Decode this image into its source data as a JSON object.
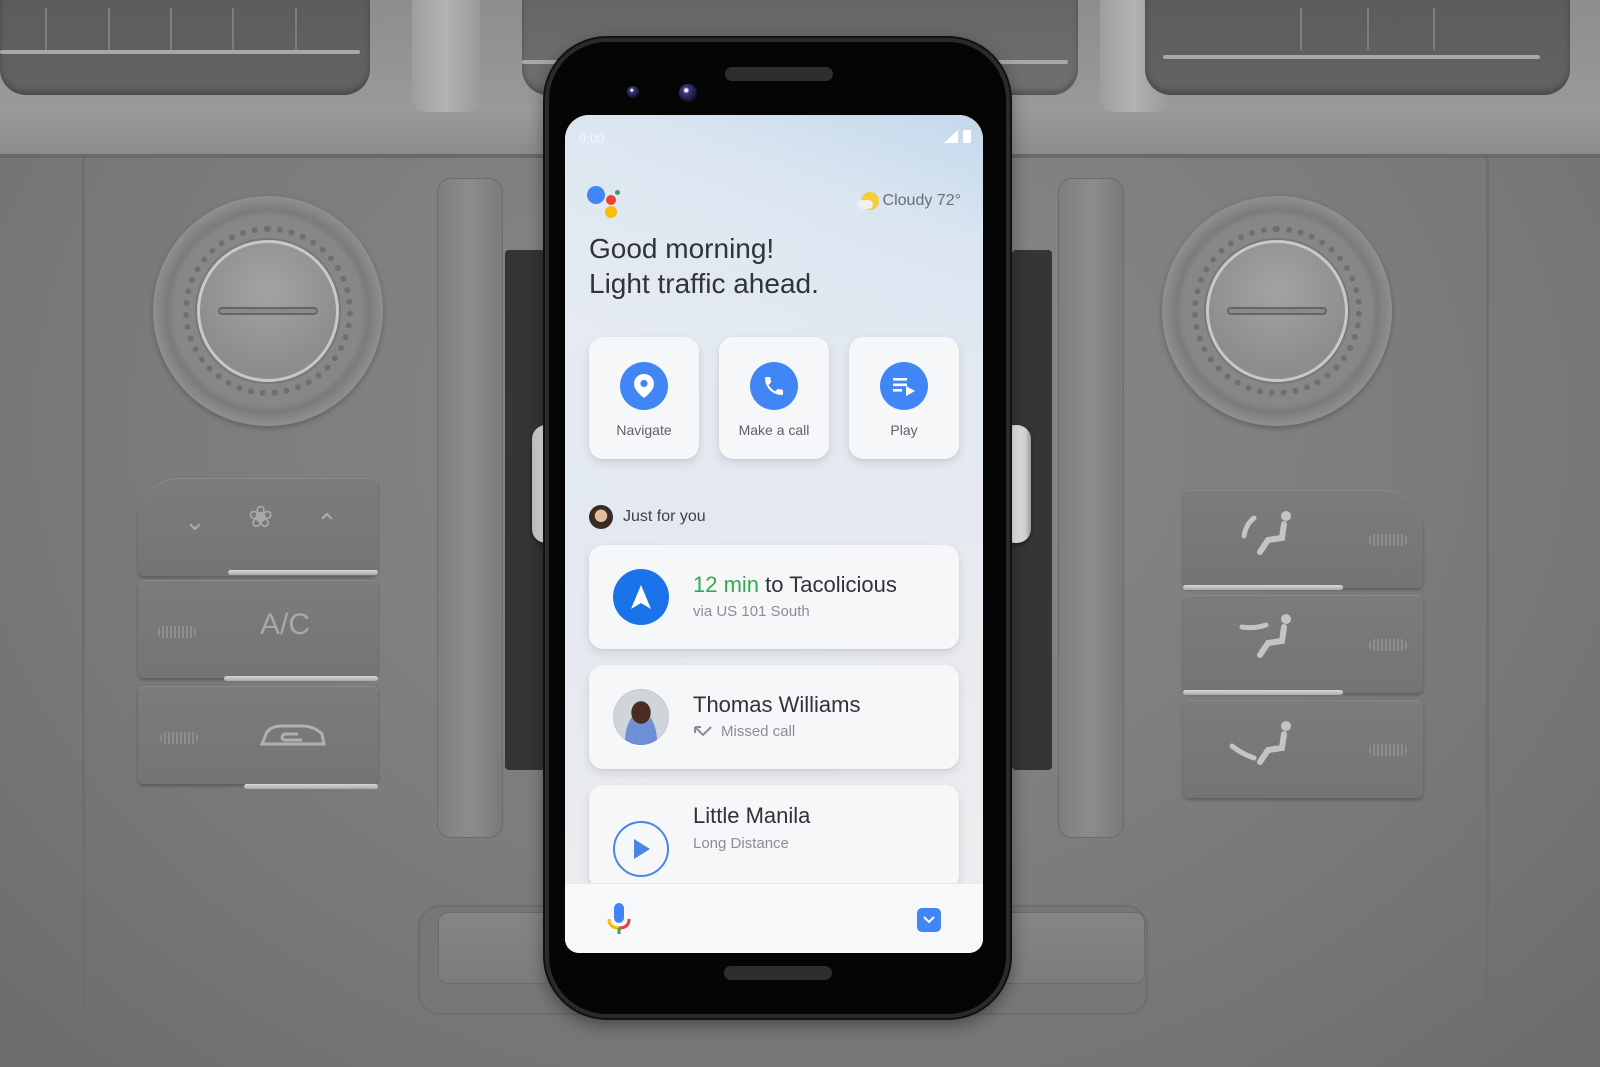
{
  "background": {
    "dash_labels": {
      "ac": "A/C"
    }
  },
  "phone": {
    "status_bar": {
      "time": "9:00",
      "signal_icon": "cell-signal-icon",
      "battery_icon": "battery-icon"
    },
    "header": {
      "assistant_logo": "google-assistant-logo",
      "weather": {
        "icon": "partly-cloudy-icon",
        "text": "Cloudy 72°"
      },
      "greeting_line1": "Good morning!",
      "greeting_line2": "Light traffic ahead."
    },
    "quick_actions": [
      {
        "label": "Navigate",
        "icon": "location-pin-icon"
      },
      {
        "label": "Make a call",
        "icon": "phone-icon"
      },
      {
        "label": "Play",
        "icon": "playlist-play-icon"
      }
    ],
    "section": {
      "label": "Just for you",
      "avatar_icon": "user-avatar"
    },
    "cards": [
      {
        "highlight": "12 min",
        "title_rest": " to Tacolicious",
        "subtitle": "via US 101 South",
        "icon": "navigation-arrow-icon"
      },
      {
        "title": "Thomas Williams",
        "subtitle": "Missed call",
        "subtitle_icon": "missed-call-icon",
        "icon": "contact-photo"
      },
      {
        "title": "Little Manila",
        "subtitle": "Long Distance",
        "icon": "play-icon"
      }
    ],
    "bottom_bar": {
      "mic_icon": "microphone-icon",
      "keyboard_icon": "chevron-down-icon"
    }
  },
  "colors": {
    "accent_blue": "#4285f4",
    "nav_blue": "#1a73e8",
    "eta_green": "#34a853",
    "assistant_red": "#ea4335",
    "assistant_yellow": "#fbbc05",
    "assistant_green": "#34a853"
  }
}
